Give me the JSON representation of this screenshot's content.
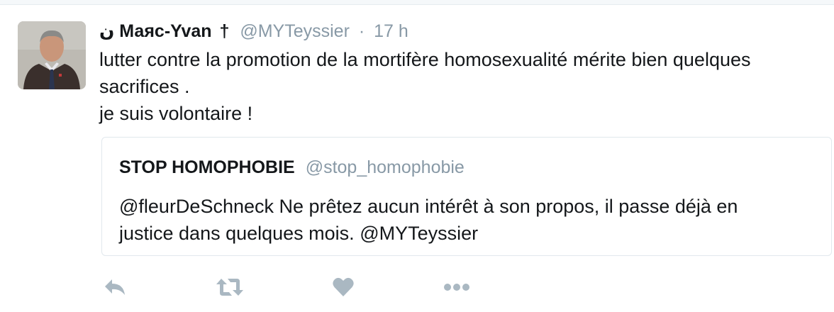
{
  "tweet": {
    "author": {
      "prefix_glyph": "ن",
      "name": "Маяс-Yvan",
      "suffix_glyph": "†",
      "handle": "@MYTeyssier",
      "separator": "·",
      "time": "17 h"
    },
    "text_lines": [
      "lutter contre la promotion de la mortifère homosexualité mérite bien quelques",
      "sacrifices .",
      "je suis volontaire !"
    ],
    "quoted": {
      "name": "STOP HOMOPHOBIE",
      "handle": "@stop_homophobie",
      "text_lines": [
        "@fleurDeSchneck Ne prêtez aucun intérêt à son propos, il passe déjà en",
        "justice dans quelques mois. @MYTeyssier"
      ]
    },
    "actions": [
      {
        "icon": "reply-icon"
      },
      {
        "icon": "retweet-icon"
      },
      {
        "icon": "like-icon"
      },
      {
        "icon": "more-icon"
      }
    ]
  },
  "colors": {
    "primary_text": "#14171a",
    "secondary_text": "#8899a6",
    "action_icon": "#aab8c2",
    "border": "#e1e8ed"
  }
}
